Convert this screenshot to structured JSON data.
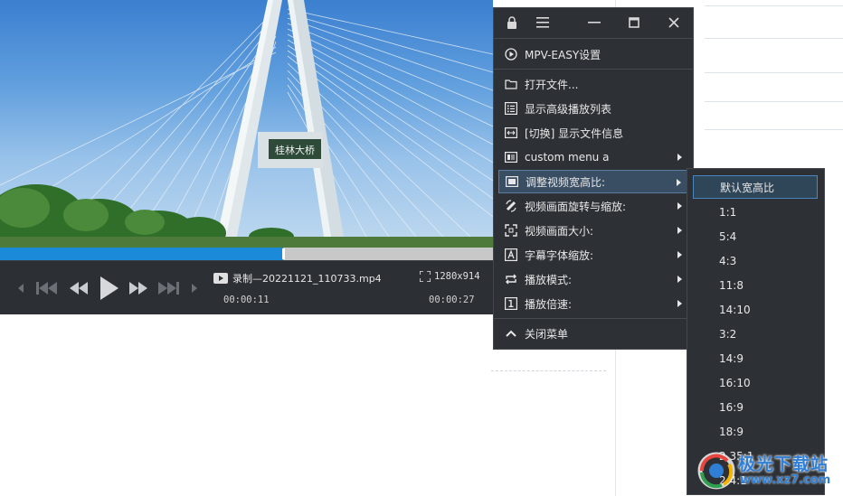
{
  "player": {
    "file_name": "录制—20221121_110733.mp4",
    "resolution": "1280x914",
    "time_current": "00:00:11",
    "time_total": "00:00:27",
    "progress_fraction": 0.575,
    "bridge_sign": "桂林大桥"
  },
  "menu": {
    "settings": "MPV-EASY设置",
    "items": [
      {
        "label": "打开文件..."
      },
      {
        "label": "显示高级播放列表"
      },
      {
        "label": "[切换] 显示文件信息"
      },
      {
        "label": "custom menu a"
      },
      {
        "label": "调整视频宽高比:"
      },
      {
        "label": "视频画面旋转与缩放:"
      },
      {
        "label": "视频画面大小:"
      },
      {
        "label": "字幕字体缩放:"
      },
      {
        "label": "播放模式:"
      },
      {
        "label": "播放倍速:"
      }
    ],
    "close": "关闭菜单"
  },
  "submenu": {
    "items": [
      "默认宽高比",
      "1:1",
      "5:4",
      "4:3",
      "11:8",
      "14:10",
      "3:2",
      "14:9",
      "16:10",
      "16:9",
      "18:9",
      "2.35:1",
      "2.4:1"
    ]
  },
  "watermark": {
    "name": "极光下载站",
    "url": "www.xz7.com"
  },
  "colors": {
    "menu_bg": "#2d3135",
    "highlight": "#3a4e63",
    "progress": "#1b8ad8",
    "control_bar": "#2c2f33"
  }
}
